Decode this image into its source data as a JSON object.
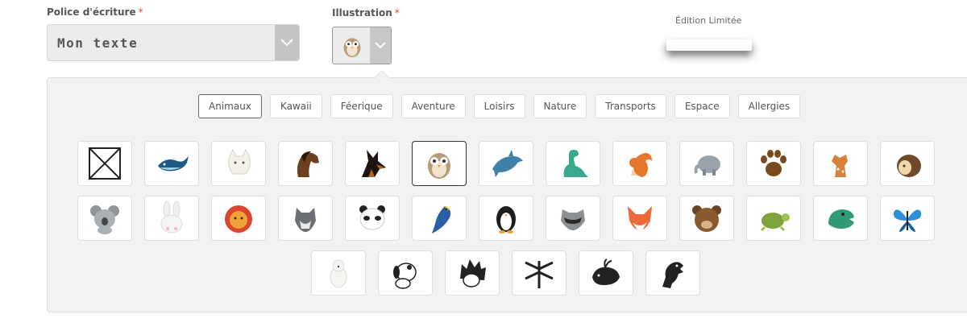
{
  "form": {
    "font_label": "Police d'écriture",
    "font_required": "*",
    "font_value": "Mon texte",
    "illustration_label": "Illustration",
    "illustration_required": "*",
    "selected_illustration": "owl"
  },
  "edition_text": "Édition Limitée",
  "tabs": [
    {
      "label": "Animaux",
      "active": true
    },
    {
      "label": "Kawaii",
      "active": false
    },
    {
      "label": "Féerique",
      "active": false
    },
    {
      "label": "Aventure",
      "active": false
    },
    {
      "label": "Loisirs",
      "active": false
    },
    {
      "label": "Nature",
      "active": false
    },
    {
      "label": "Transports",
      "active": false
    },
    {
      "label": "Espace",
      "active": false
    },
    {
      "label": "Allergies",
      "active": false
    }
  ],
  "icons": [
    [
      "none",
      "whale",
      "cat",
      "horse",
      "doberman",
      "owl",
      "dolphin",
      "dinosaur",
      "squirrel",
      "elephant",
      "paw",
      "deer",
      "hedgehog"
    ],
    [
      "koala",
      "bunny",
      "lion",
      "wolf",
      "panda",
      "parrot",
      "penguin",
      "raccoon",
      "fox",
      "bear",
      "turtle",
      "trex",
      "butterfly"
    ],
    [
      "polar-bear",
      "dalmatian",
      "hedgehog-bw",
      "dragonfly",
      "whale-bw",
      "dino-bw"
    ]
  ],
  "colors": {
    "accent": "#e04848",
    "panel": "#f2f2f2"
  }
}
